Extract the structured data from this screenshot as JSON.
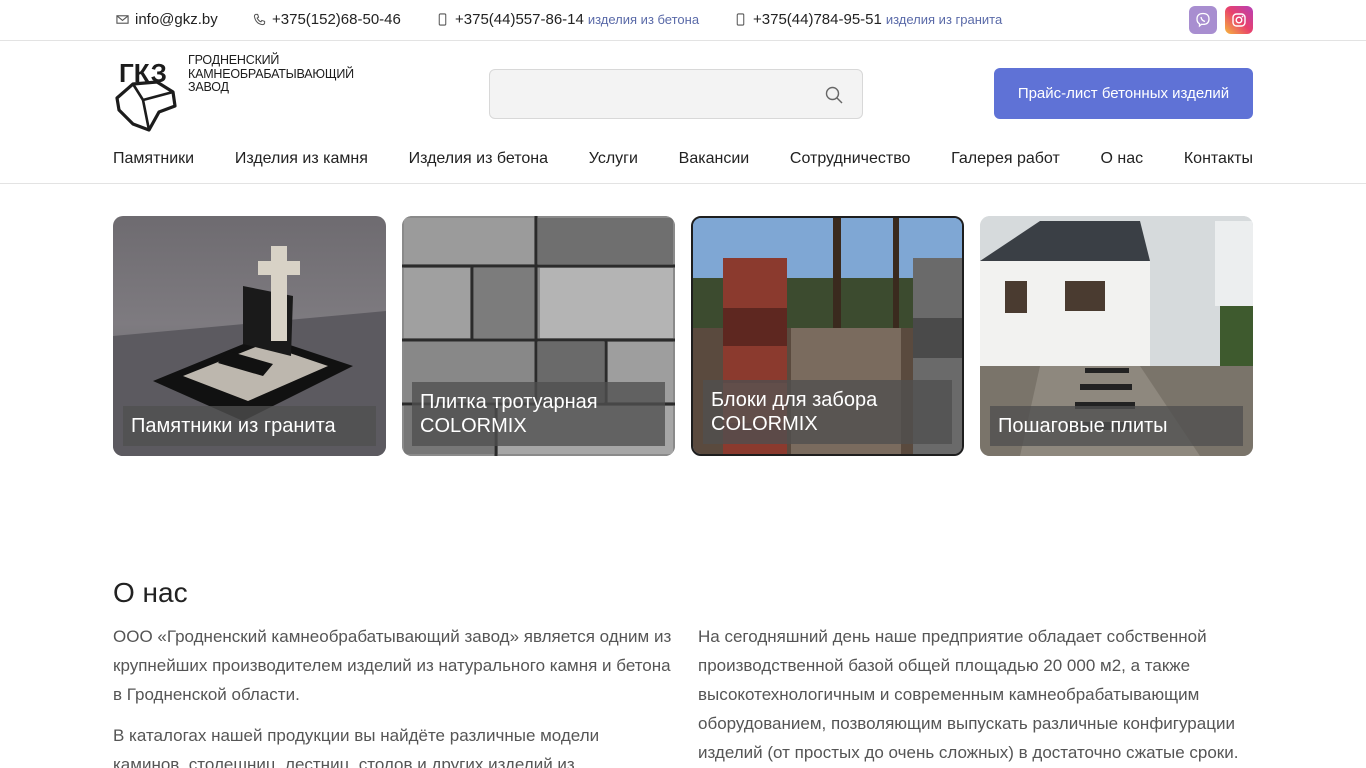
{
  "topbar": {
    "email": "info@gkz.by",
    "phone1": "+375(152)68-50-46",
    "phone2": "+375(44)557-86-14",
    "phone2_note": "изделия из бетона",
    "phone3": "+375(44)784-95-51",
    "phone3_note": "изделия из гранита",
    "icons": [
      "mail-icon",
      "phone-icon",
      "mobile-icon",
      "mobile-icon",
      "viber-icon",
      "instagram-icon"
    ]
  },
  "logo": {
    "mark": "ГКЗ",
    "line1": "Гродненский",
    "line2": "камнеобрабатывающий",
    "line3": "завод"
  },
  "search": {
    "placeholder": "",
    "value": ""
  },
  "price_button": "Прайс-лист бетонных изделий",
  "nav": [
    "Памятники",
    "Изделия из камня",
    "Изделия из бетона",
    "Услуги",
    "Вакансии",
    "Сотрудничество",
    "Галерея работ",
    "О нас",
    "Контакты"
  ],
  "cards": [
    {
      "title": "Памятники из гранита"
    },
    {
      "title": "Плитка тротуарная COLORMIX"
    },
    {
      "title": "Блоки для забора COLORMIX"
    },
    {
      "title": "Пошаговые плиты"
    }
  ],
  "about": {
    "title": "О нас",
    "left_p1": "ООО «Гродненский камнеобрабатывающий завод» является одним из крупнейших производителем изделий из натурального камня и бетона в Гродненской области.",
    "left_p2": "В каталогах нашей продукции вы найдёте различные модели каминов, столешниц, лестниц, столов и других изделий из",
    "right_p1": "На сегодняшний день наше предприятие обладает собственной производственной базой общей площадью 20 000 м2, а также высокотехнологичным и современным камнеобрабатывающим оборудованием, позволяющим выпускать различные конфигурации изделий (от простых до очень сложных) в достаточно сжатые сроки."
  },
  "colors": {
    "accent": "#5f72d6",
    "note": "#5a6aa8",
    "text": "#222222",
    "muted": "#555555",
    "viber": "#a88ed0"
  }
}
